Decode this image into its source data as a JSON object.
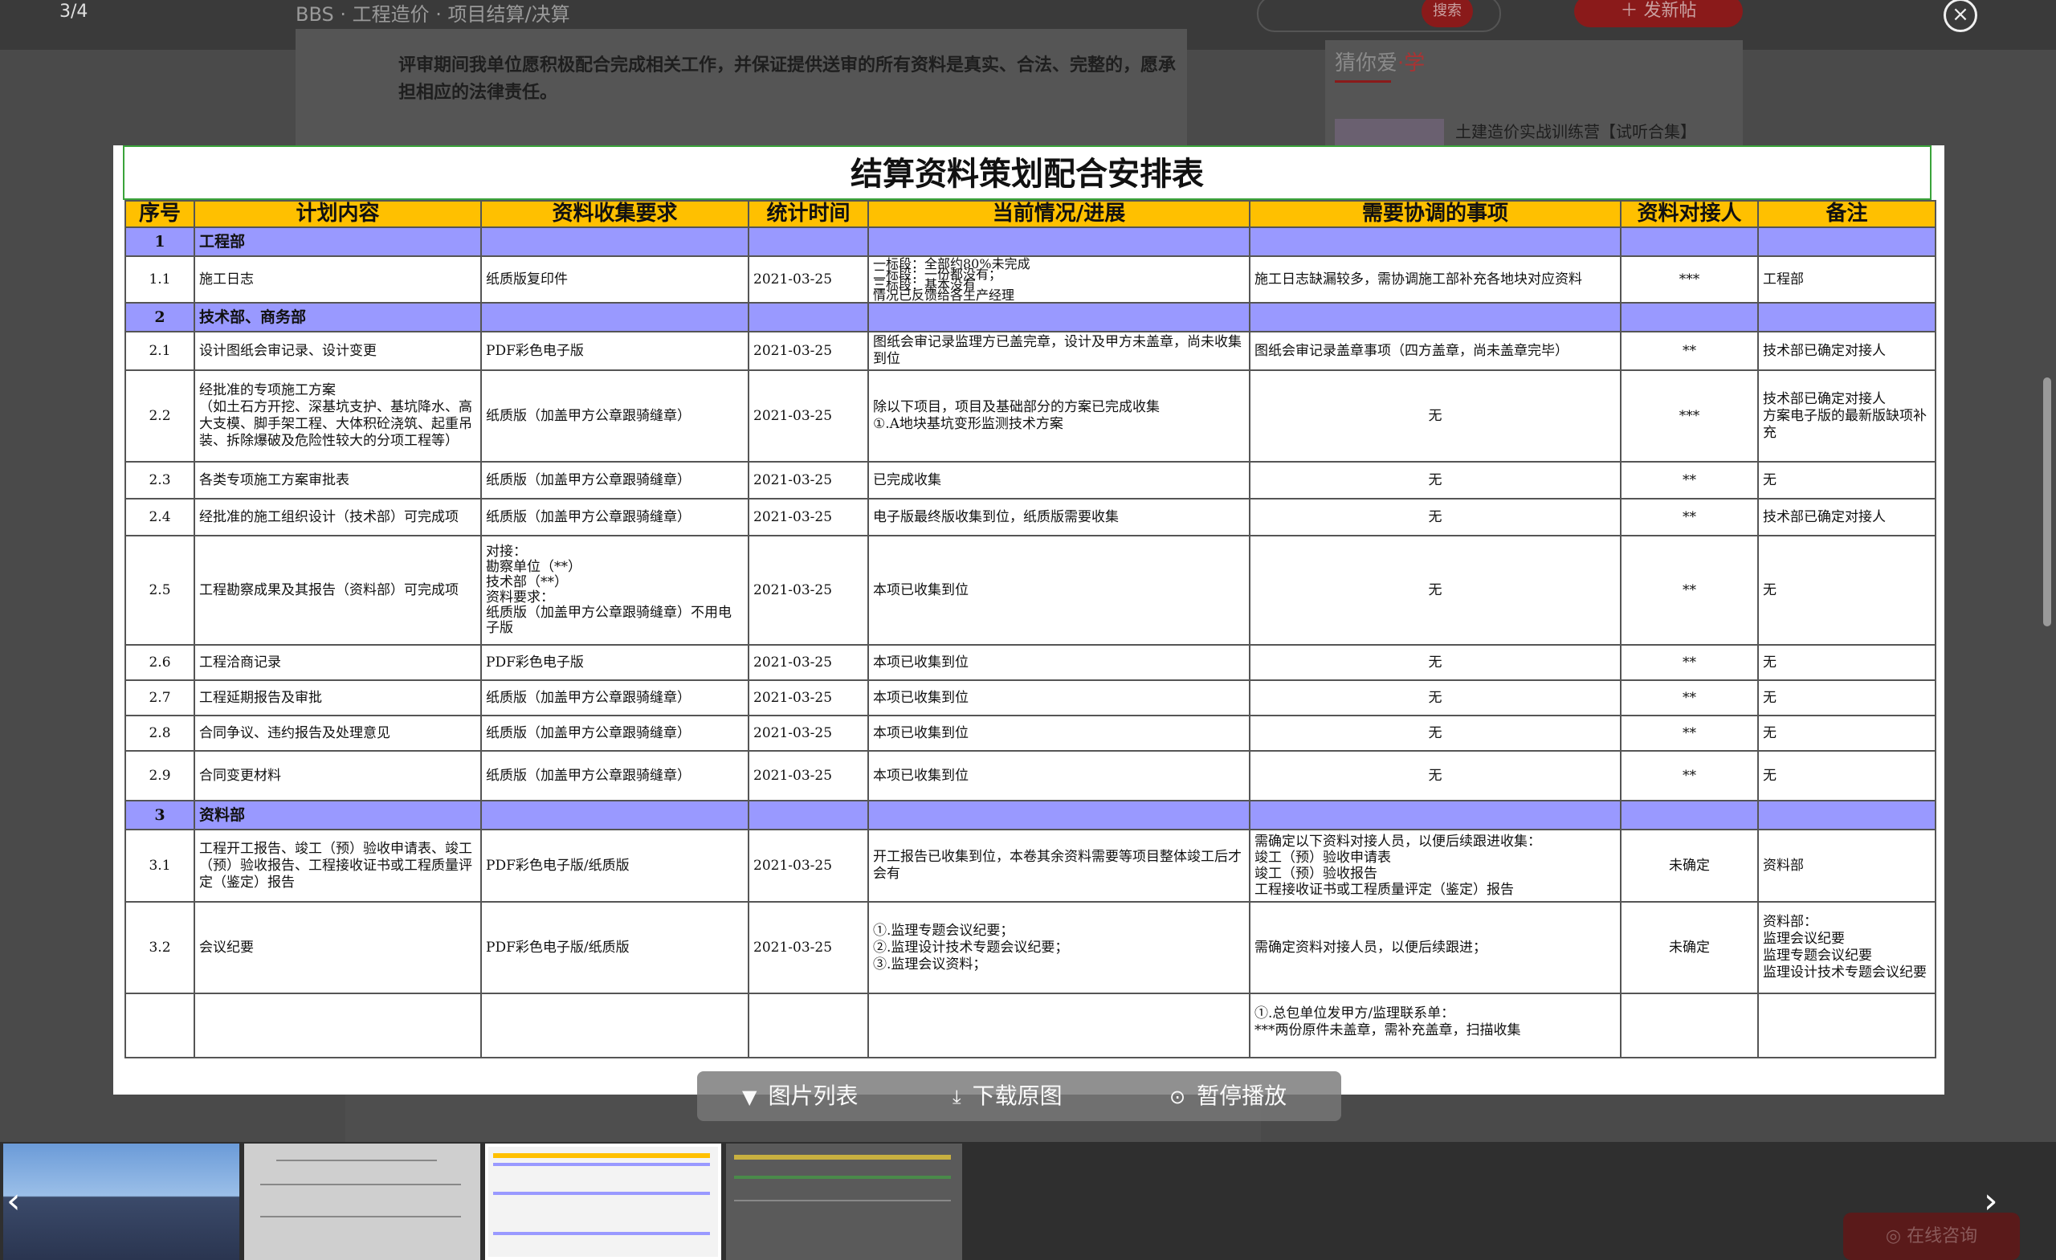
{
  "viewer": {
    "counter": "3/4",
    "close_icon": "close-icon"
  },
  "background": {
    "breadcrumb": "BBS · 工程造价 · 项目结算/决算",
    "search_button": "搜索",
    "post_button": "发新帖",
    "doc_text": "评审期间我单位愿积极配合完成相关工作，并保证提供送审的所有资料是真实、合法、完整的，愿承担相应的法律责任。",
    "side_title_a": "猜你爱",
    "side_title_b": "学",
    "side_item": "土建造价实战训练营【试听合集】",
    "online_button": "在线咨询"
  },
  "sheet": {
    "title": "结算资料策划配合安排表",
    "headers": [
      "序号",
      "计划内容",
      "资料收集要求",
      "统计时间",
      "当前情况/进展",
      "需要协调的事项",
      "资料对接人",
      "备注"
    ],
    "sections": {
      "s1": {
        "no": "1",
        "name": "工程部"
      },
      "s2": {
        "no": "2",
        "name": "技术部、商务部"
      },
      "s3": {
        "no": "3",
        "name": "资料部"
      }
    },
    "rows": {
      "r11": {
        "no": "1.1",
        "content": "施工日志",
        "req": "纸质版复印件",
        "date": "2021-03-25",
        "status": "一标段：全部约80%未完成\n二标段：一份都没有；\n三标段：基本没有\n情况已反馈给各生产经理",
        "coord": "施工日志缺漏较多，需协调施工部补充各地块对应资料",
        "contact": "***",
        "note": "工程部"
      },
      "r21": {
        "no": "2.1",
        "content": "设计图纸会审记录、设计变更",
        "req": "PDF彩色电子版",
        "date": "2021-03-25",
        "status": "图纸会审记录监理方已盖完章，设计及甲方未盖章，尚未收集到位",
        "coord": "图纸会审记录盖章事项（四方盖章，尚未盖章完毕）",
        "contact": "**",
        "note": "技术部已确定对接人"
      },
      "r22": {
        "no": "2.2",
        "content": "经批准的专项施工方案\n（如土石方开挖、深基坑支护、基坑降水、高大支模、脚手架工程、大体积砼浇筑、起重吊装、拆除爆破及危险性较大的分项工程等）",
        "req": "纸质版（加盖甲方公章跟骑缝章）",
        "date": "2021-03-25",
        "status": "除以下项目，项目及基础部分的方案已完成收集\n①.A地块基坑变形监测技术方案",
        "coord": "无",
        "contact": "***",
        "note": "技术部已确定对接人\n方案电子版的最新版缺项补充"
      },
      "r23": {
        "no": "2.3",
        "content": "各类专项施工方案审批表",
        "req": "纸质版（加盖甲方公章跟骑缝章）",
        "date": "2021-03-25",
        "status": "已完成收集",
        "coord": "无",
        "contact": "**",
        "note": "无"
      },
      "r24": {
        "no": "2.4",
        "content": "经批准的施工组织设计（技术部）可完成项",
        "req": "纸质版（加盖甲方公章跟骑缝章）",
        "date": "2021-03-25",
        "status": "电子版最终版收集到位，纸质版需要收集",
        "coord": "无",
        "contact": "**",
        "note": "技术部已确定对接人"
      },
      "r25": {
        "no": "2.5",
        "content": "工程勘察成果及其报告（资料部）可完成项",
        "req": "对接：\n勘察单位（**）\n技术部（**）\n资料要求：\n纸质版（加盖甲方公章跟骑缝章）不用电子版",
        "date": "2021-03-25",
        "status": "本项已收集到位",
        "coord": "无",
        "contact": "**",
        "note": "无"
      },
      "r26": {
        "no": "2.6",
        "content": "工程洽商记录",
        "req": "PDF彩色电子版",
        "date": "2021-03-25",
        "status": "本项已收集到位",
        "coord": "无",
        "contact": "**",
        "note": "无"
      },
      "r27": {
        "no": "2.7",
        "content": "工程延期报告及审批",
        "req": "纸质版（加盖甲方公章跟骑缝章）",
        "date": "2021-03-25",
        "status": "本项已收集到位",
        "coord": "无",
        "contact": "**",
        "note": "无"
      },
      "r28": {
        "no": "2.8",
        "content": "合同争议、违约报告及处理意见",
        "req": "纸质版（加盖甲方公章跟骑缝章）",
        "date": "2021-03-25",
        "status": "本项已收集到位",
        "coord": "无",
        "contact": "**",
        "note": "无"
      },
      "r29": {
        "no": "2.9",
        "content": "合同变更材料",
        "req": "纸质版（加盖甲方公章跟骑缝章）",
        "date": "2021-03-25",
        "status": "本项已收集到位",
        "coord": "无",
        "contact": "**",
        "note": "无"
      },
      "r31": {
        "no": "3.1",
        "content": "工程开工报告、竣工（预）验收申请表、竣工（预）验收报告、工程接收证书或工程质量评定（鉴定）报告",
        "req": "PDF彩色电子版/纸质版",
        "date": "2021-03-25",
        "status": "开工报告已收集到位，本卷其余资料需要等项目整体竣工后才会有",
        "coord": "需确定以下资料对接人员，以便后续跟进收集：\n竣工（预）验收申请表\n竣工（预）验收报告\n工程接收证书或工程质量评定（鉴定）报告",
        "contact": "未确定",
        "note": "资料部"
      },
      "r32": {
        "no": "3.2",
        "content": "会议纪要",
        "req": "PDF彩色电子版/纸质版",
        "date": "2021-03-25",
        "status": "①.监理专题会议纪要；\n②.监理设计技术专题会议纪要；\n③.监理会议资料；",
        "coord": "需确定资料对接人员，以便后续跟进；",
        "contact": "未确定",
        "note": "资料部：\n监理会议纪要\n监理专题会议纪要\n监理设计技术专题会议纪要"
      },
      "r33": {
        "coord": "①.总包单位发甲方/监理联系单：\n***两份原件未盖章，需补充盖章，扫描收集"
      }
    }
  },
  "toolbar": {
    "image_list": "图片列表",
    "download": "下载原图",
    "pause": "暂停播放"
  }
}
